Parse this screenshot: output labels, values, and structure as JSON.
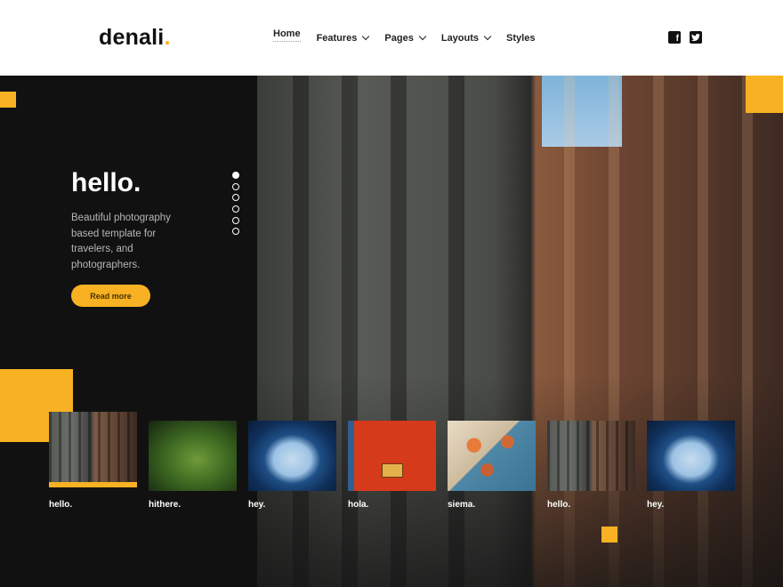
{
  "brand": {
    "name": "denali",
    "dot": ".",
    "accent_color": "#f7b122"
  },
  "nav": {
    "items": [
      {
        "label": "Home",
        "active": true,
        "dropdown": false
      },
      {
        "label": "Features",
        "active": false,
        "dropdown": true
      },
      {
        "label": "Pages",
        "active": false,
        "dropdown": true
      },
      {
        "label": "Layouts",
        "active": false,
        "dropdown": true
      },
      {
        "label": "Styles",
        "active": false,
        "dropdown": false
      }
    ]
  },
  "social": {
    "icons": [
      "facebook-icon",
      "twitter-icon"
    ]
  },
  "hero": {
    "title": "hello.",
    "description": "Beautiful photography based template for travelers, and photographers.",
    "button_label": "Read more",
    "slide_count": 6,
    "active_slide": 1
  },
  "thumbnails": [
    {
      "label": "hello.",
      "image": "building",
      "active": true
    },
    {
      "label": "hithere.",
      "image": "moss",
      "active": false
    },
    {
      "label": "hey.",
      "image": "airplane-window",
      "active": false
    },
    {
      "label": "hola.",
      "image": "red-door",
      "active": false
    },
    {
      "label": "siema.",
      "image": "food",
      "active": false
    },
    {
      "label": "hello.",
      "image": "building",
      "active": false
    },
    {
      "label": "hey.",
      "image": "airplane-window",
      "active": false
    }
  ]
}
